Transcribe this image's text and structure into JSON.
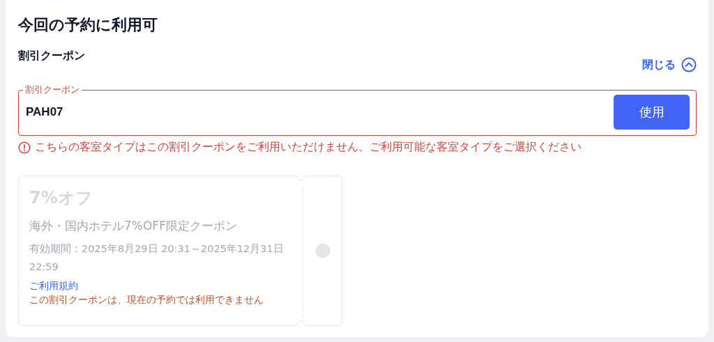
{
  "title": "今回の予約に利用可",
  "section": {
    "label": "割引クーポン",
    "toggle": {
      "label": "閉じる",
      "expanded": true
    }
  },
  "coupon_field": {
    "label": "割引クーポン",
    "value": "PAH07",
    "invalid": true,
    "button": "使用"
  },
  "error": "こちらの客室タイプはこの割引クーポンをご利用いただけません、ご利用可能な客室タイプをご選択ください",
  "coupons": [
    {
      "discount": "7%オフ",
      "name": "海外・国内ホテル7%OFF限定クーポン",
      "validity": "有効期間：2025年8月29日 20:31～2025年12月31日 22:59",
      "terms": "ご利用規約",
      "notice": "この割引クーポンは、現在の予約では利用できません",
      "disabled": true,
      "selected": false
    }
  ]
}
